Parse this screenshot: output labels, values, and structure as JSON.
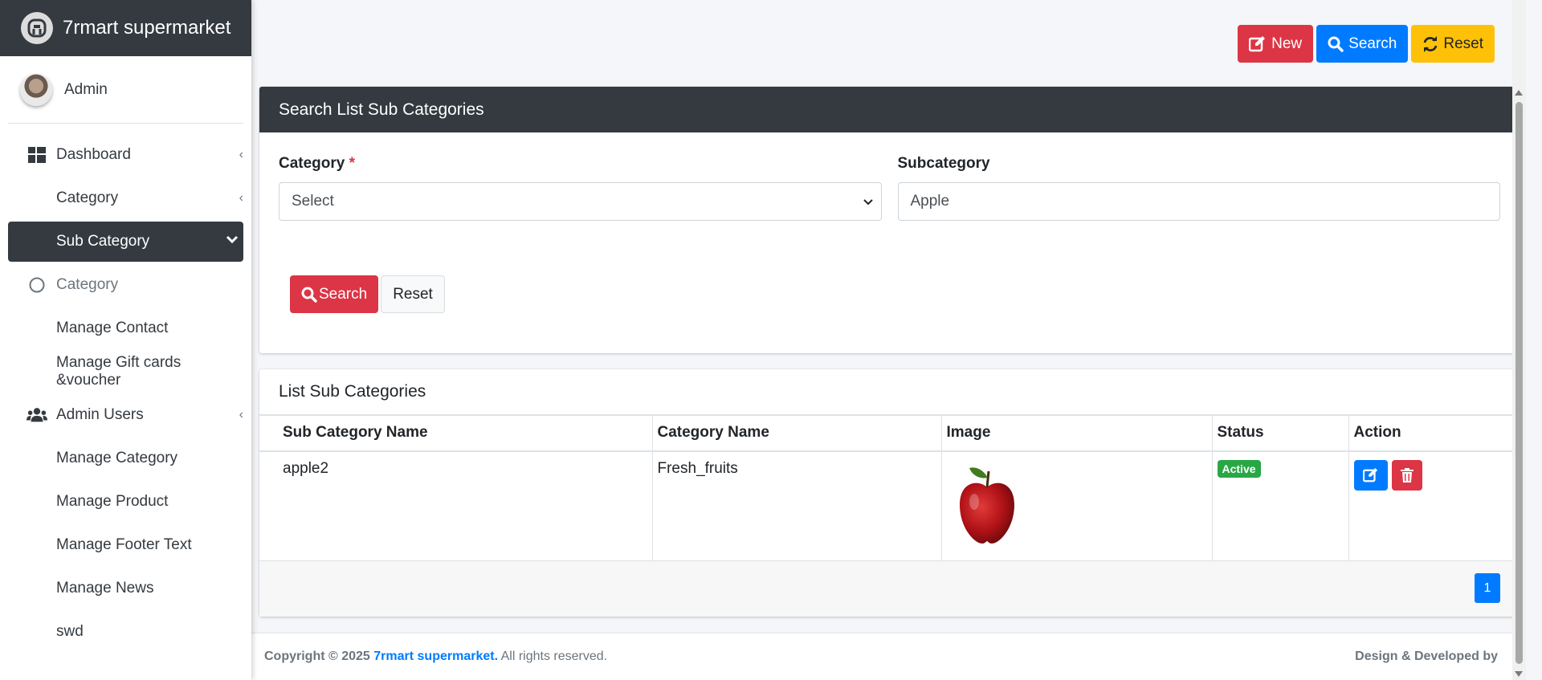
{
  "brand": {
    "title": "7rmart supermarket"
  },
  "user": {
    "name": "Admin"
  },
  "sidebar": {
    "items": [
      {
        "label": "Dashboard"
      },
      {
        "label": "Category"
      },
      {
        "label": "Sub Category"
      },
      {
        "label": "Category"
      },
      {
        "label": "Manage Contact"
      },
      {
        "label": "Manage Gift cards &voucher"
      },
      {
        "label": "Admin Users"
      },
      {
        "label": "Manage Category"
      },
      {
        "label": "Manage Product"
      },
      {
        "label": "Manage Footer Text"
      },
      {
        "label": "Manage News"
      },
      {
        "label": "swd"
      }
    ]
  },
  "toolbar": {
    "new_label": "New",
    "search_label": "Search",
    "reset_label": "Reset"
  },
  "search_card": {
    "title": "Search List Sub Categories",
    "category_label": "Category",
    "required_mark": "*",
    "category_value": "Select",
    "subcategory_label": "Subcategory",
    "subcategory_value": "Apple",
    "search_button": "Search",
    "reset_button": "Reset"
  },
  "list_card": {
    "title": "List Sub Categories",
    "columns": [
      "Sub Category Name",
      "Category Name",
      "Image",
      "Status",
      "Action"
    ],
    "rows": [
      {
        "sub_category": "apple2",
        "category": "Fresh_fruits",
        "status": "Active"
      }
    ],
    "page": "1"
  },
  "footer": {
    "copyright_prefix": "Copyright © 2025",
    "brand_link": "7rmart supermarket.",
    "rights": "All rights reserved.",
    "credit": "Design & Developed by"
  },
  "colors": {
    "dark": "#343a40",
    "danger": "#dc3545",
    "primary": "#007bff",
    "warning": "#ffc107",
    "success": "#28a745"
  }
}
